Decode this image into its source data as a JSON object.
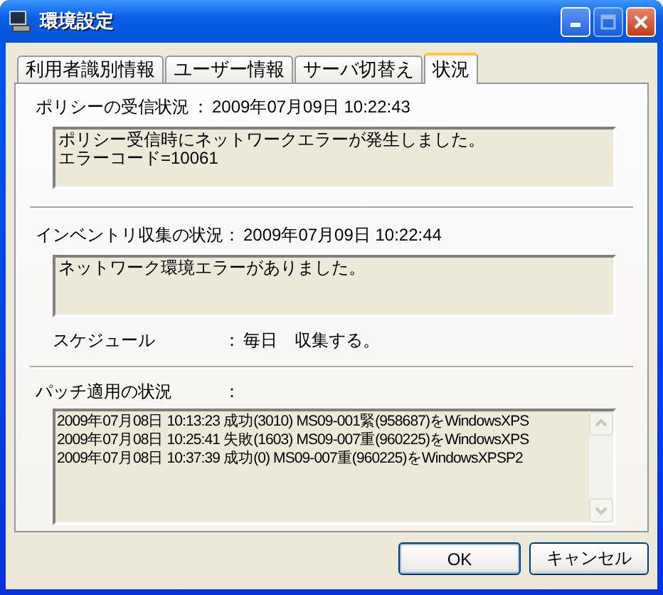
{
  "window": {
    "title": "環境設定"
  },
  "tabs": [
    {
      "label": "利用者識別情報",
      "selected": false
    },
    {
      "label": "ユーザー情報",
      "selected": false
    },
    {
      "label": "サーバ切替え",
      "selected": false
    },
    {
      "label": "状況",
      "selected": true
    }
  ],
  "policy": {
    "label": "ポリシーの受信状況",
    "colon": "：",
    "timestamp": "2009年07月09日 10:22:43",
    "message_lines": [
      "ポリシー受信時にネットワークエラーが発生しました。",
      "エラーコード=10061"
    ]
  },
  "inventory": {
    "label": "インベントリ収集の状況",
    "colon": "：",
    "timestamp": "2009年07月09日 10:22:44",
    "message_lines": [
      "ネットワーク環境エラーがありました。"
    ]
  },
  "schedule": {
    "label": "スケジュール",
    "colon": "：",
    "value": "毎日　収集する。"
  },
  "patch": {
    "label": "パッチ適用の状況",
    "colon": "：",
    "log_lines": [
      "2009年07月08日 10:13:23 成功(3010) MS09-001緊(958687)をWindowsXPS",
      "2009年07月08日 10:25:41 失敗(1603) MS09-007重(960225)をWindowsXPS",
      "2009年07月08日 10:37:39 成功(0) MS09-007重(960225)をWindowsXPSP2"
    ]
  },
  "buttons": [
    "OK",
    "キャンセル"
  ]
}
